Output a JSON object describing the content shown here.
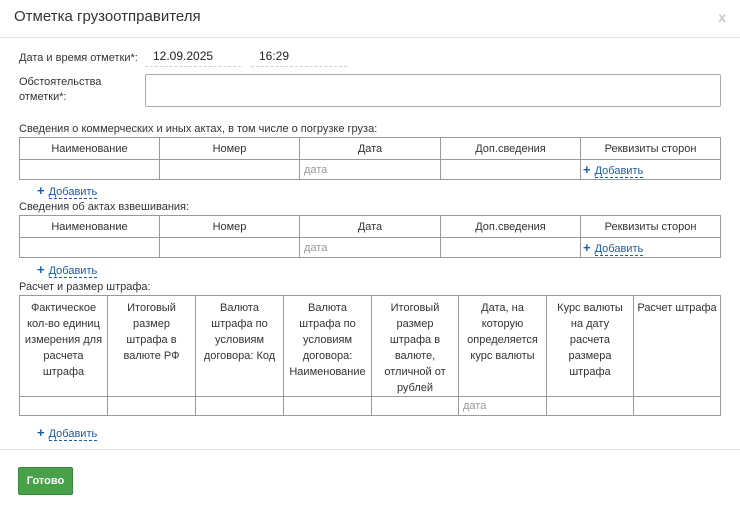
{
  "dialog": {
    "title": "Отметка грузоотправителя",
    "close_label": "x"
  },
  "datetime": {
    "label": "Дата и время отметки*:",
    "date": "12.09.2025",
    "time": "16:29"
  },
  "circumstances": {
    "label_line1": "Обстоятельства",
    "label_line2": "отметки*:",
    "value": ""
  },
  "commercial_acts": {
    "title": "Сведения о коммерческих и иных актах, в том числе о погрузке груза:",
    "columns": [
      "Наименование",
      "Номер",
      "Дата",
      "Доп.сведения",
      "Реквизиты сторон"
    ],
    "date_placeholder": "дата",
    "inline_add": "Добавить",
    "add_label": "Добавить"
  },
  "weighing_acts": {
    "title": "Сведения об актах взвешивания:",
    "columns": [
      "Наименование",
      "Номер",
      "Дата",
      "Доп.сведения",
      "Реквизиты сторон"
    ],
    "date_placeholder": "дата",
    "inline_add": "Добавить",
    "add_label": "Добавить"
  },
  "fine": {
    "title": "Расчет и размер штрафа:",
    "columns": [
      "Фактическое кол-во единиц измерения для расчета штрафа",
      "Итоговый размер штрафа в валюте РФ",
      "Валюта штрафа по условиям договора: Код",
      "Валюта штрафа по условиям договора: Наименование",
      "Итоговый размер штрафа в валюте, отличной от рублей",
      "Дата, на которую определяется курс валюты",
      "Курс валюты на дату расчета размера штрафа",
      "Расчет штрафа"
    ],
    "date_placeholder": "дата",
    "add_label": "Добавить"
  },
  "footer": {
    "done_label": "Готово"
  },
  "colors": {
    "accent_green": "#48a048",
    "link_blue": "#1a5ca8"
  }
}
